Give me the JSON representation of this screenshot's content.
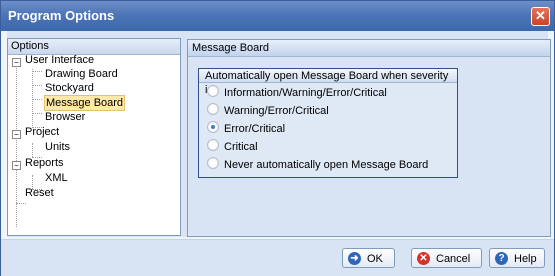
{
  "window": {
    "title": "Program Options",
    "close_glyph": "✕"
  },
  "options_panel": {
    "header": "Options",
    "tree": [
      {
        "label": "User Interface",
        "expander": "−"
      },
      {
        "label": "Drawing Board"
      },
      {
        "label": "Stockyard"
      },
      {
        "label": "Message Board",
        "selected": true
      },
      {
        "label": "Browser"
      },
      {
        "label": "Project",
        "expander": "−"
      },
      {
        "label": "Units"
      },
      {
        "label": "Reports",
        "expander": "−"
      },
      {
        "label": "XML"
      },
      {
        "label": "Reset"
      }
    ]
  },
  "message_board": {
    "header": "Message Board",
    "group_title": "Automatically open Message Board when severity is:",
    "options": [
      {
        "label": "Information/Warning/Error/Critical",
        "selected": false
      },
      {
        "label": "Warning/Error/Critical",
        "selected": false
      },
      {
        "label": "Error/Critical",
        "selected": true
      },
      {
        "label": "Critical",
        "selected": false
      },
      {
        "label": "Never automatically open Message Board",
        "selected": false
      }
    ]
  },
  "buttons": {
    "ok": {
      "label": "OK",
      "icon": "ok-arrow-icon",
      "color": "#2f67b8"
    },
    "cancel": {
      "label": "Cancel",
      "icon": "cancel-x-icon",
      "color": "#d2332a"
    },
    "help": {
      "label": "Help",
      "icon": "help-question-icon",
      "color": "#2f67b8"
    }
  }
}
